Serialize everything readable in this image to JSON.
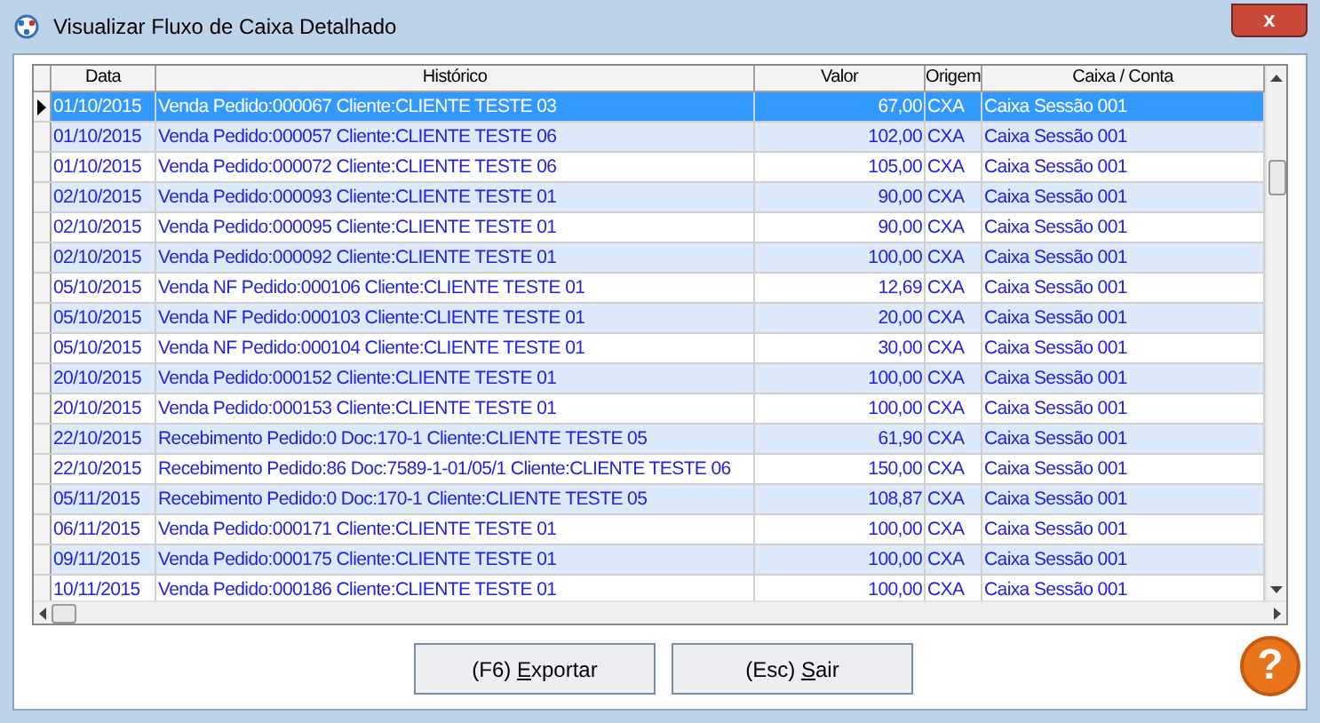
{
  "window": {
    "title": "Visualizar Fluxo de Caixa Detalhado",
    "close_label": "x"
  },
  "table": {
    "columns": [
      "Data",
      "Histórico",
      "Valor",
      "Origem",
      "Caixa / Conta"
    ],
    "rows": [
      {
        "selected": true,
        "cells": [
          "01/10/2015",
          "Venda Pedido:000067 Cliente:CLIENTE TESTE 03",
          "67,00",
          "CXA",
          "Caixa Sessão 001"
        ]
      },
      {
        "selected": false,
        "cells": [
          "01/10/2015",
          "Venda Pedido:000057 Cliente:CLIENTE TESTE 06",
          "102,00",
          "CXA",
          "Caixa Sessão 001"
        ]
      },
      {
        "selected": false,
        "cells": [
          "01/10/2015",
          "Venda Pedido:000072 Cliente:CLIENTE TESTE 06",
          "105,00",
          "CXA",
          "Caixa Sessão 001"
        ]
      },
      {
        "selected": false,
        "cells": [
          "02/10/2015",
          "Venda Pedido:000093 Cliente:CLIENTE TESTE 01",
          "90,00",
          "CXA",
          "Caixa Sessão 001"
        ]
      },
      {
        "selected": false,
        "cells": [
          "02/10/2015",
          "Venda Pedido:000095 Cliente:CLIENTE TESTE 01",
          "90,00",
          "CXA",
          "Caixa Sessão 001"
        ]
      },
      {
        "selected": false,
        "cells": [
          "02/10/2015",
          "Venda Pedido:000092 Cliente:CLIENTE TESTE 01",
          "100,00",
          "CXA",
          "Caixa Sessão 001"
        ]
      },
      {
        "selected": false,
        "cells": [
          "05/10/2015",
          "Venda NF Pedido:000106 Cliente:CLIENTE TESTE 01",
          "12,69",
          "CXA",
          "Caixa Sessão 001"
        ]
      },
      {
        "selected": false,
        "cells": [
          "05/10/2015",
          "Venda NF Pedido:000103 Cliente:CLIENTE TESTE 01",
          "20,00",
          "CXA",
          "Caixa Sessão 001"
        ]
      },
      {
        "selected": false,
        "cells": [
          "05/10/2015",
          "Venda NF Pedido:000104 Cliente:CLIENTE TESTE 01",
          "30,00",
          "CXA",
          "Caixa Sessão 001"
        ]
      },
      {
        "selected": false,
        "cells": [
          "20/10/2015",
          "Venda Pedido:000152 Cliente:CLIENTE TESTE 01",
          "100,00",
          "CXA",
          "Caixa Sessão 001"
        ]
      },
      {
        "selected": false,
        "cells": [
          "20/10/2015",
          "Venda Pedido:000153 Cliente:CLIENTE TESTE 01",
          "100,00",
          "CXA",
          "Caixa Sessão 001"
        ]
      },
      {
        "selected": false,
        "cells": [
          "22/10/2015",
          "Recebimento Pedido:0 Doc:170-1 Cliente:CLIENTE TESTE 05",
          "61,90",
          "CXA",
          "Caixa Sessão 001"
        ]
      },
      {
        "selected": false,
        "cells": [
          "22/10/2015",
          "Recebimento Pedido:86 Doc:7589-1-01/05/1 Cliente:CLIENTE TESTE 06",
          "150,00",
          "CXA",
          "Caixa Sessão 001"
        ]
      },
      {
        "selected": false,
        "cells": [
          "05/11/2015",
          "Recebimento Pedido:0 Doc:170-1 Cliente:CLIENTE TESTE 05",
          "108,87",
          "CXA",
          "Caixa Sessão 001"
        ]
      },
      {
        "selected": false,
        "cells": [
          "06/11/2015",
          "Venda Pedido:000171 Cliente:CLIENTE TESTE 01",
          "100,00",
          "CXA",
          "Caixa Sessão 001"
        ]
      },
      {
        "selected": false,
        "cells": [
          "09/11/2015",
          "Venda Pedido:000175 Cliente:CLIENTE TESTE 01",
          "100,00",
          "CXA",
          "Caixa Sessão 001"
        ]
      },
      {
        "selected": false,
        "cells": [
          "10/11/2015",
          "Venda Pedido:000186 Cliente:CLIENTE TESTE 01",
          "100,00",
          "CXA",
          "Caixa Sessão 001"
        ]
      }
    ]
  },
  "buttons": [
    {
      "prefix": "(F6) ",
      "mnemonic": "E",
      "rest": "xportar"
    },
    {
      "prefix": "(Esc) ",
      "mnemonic": "S",
      "rest": "air"
    }
  ],
  "help": {
    "label": "?"
  }
}
